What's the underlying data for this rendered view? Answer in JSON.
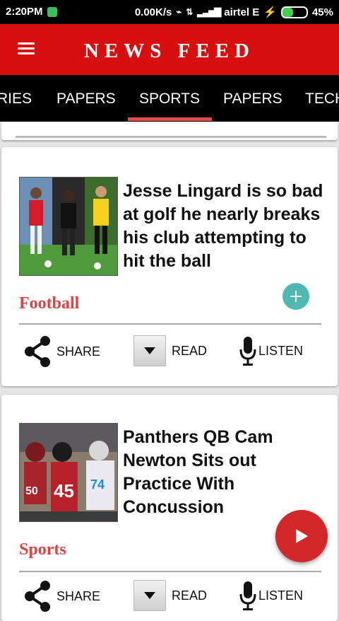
{
  "status_bar": {
    "time": "2:20PM",
    "network_speed": "0.00K/s",
    "carrier": "airtel E",
    "battery": "45%"
  },
  "app_bar": {
    "title": "NEWS FEED"
  },
  "tabs": [
    {
      "label": "RIES"
    },
    {
      "label": "PAPERS"
    },
    {
      "label": "SPORTS",
      "selected": true
    },
    {
      "label": "PAPERS"
    },
    {
      "label": "TECH"
    }
  ],
  "articles": [
    {
      "headline": "Jesse Lingard is so bad at golf he nearly breaks his club attempting to hit the ball",
      "category": "Football",
      "actions": {
        "share": "SHARE",
        "read": "READ",
        "listen": "LISTEN"
      }
    },
    {
      "headline": " Panthers QB Cam Newton Sits out Practice With Concussion",
      "category": "Sports",
      "actions": {
        "share": "SHARE",
        "read": "READ",
        "listen": "LISTEN"
      }
    }
  ],
  "colors": {
    "app_bar": "#d80f0f",
    "category_text": "#e34242",
    "add_button": "#4fb8b0",
    "fab": "#d3282a",
    "tab_indicator": "#e44a4a"
  },
  "icons": {
    "menu": "hamburger-menu-icon",
    "share": "share-icon",
    "read": "dropdown-arrow-icon",
    "listen": "microphone-icon",
    "add": "plus-icon",
    "play": "play-icon"
  }
}
